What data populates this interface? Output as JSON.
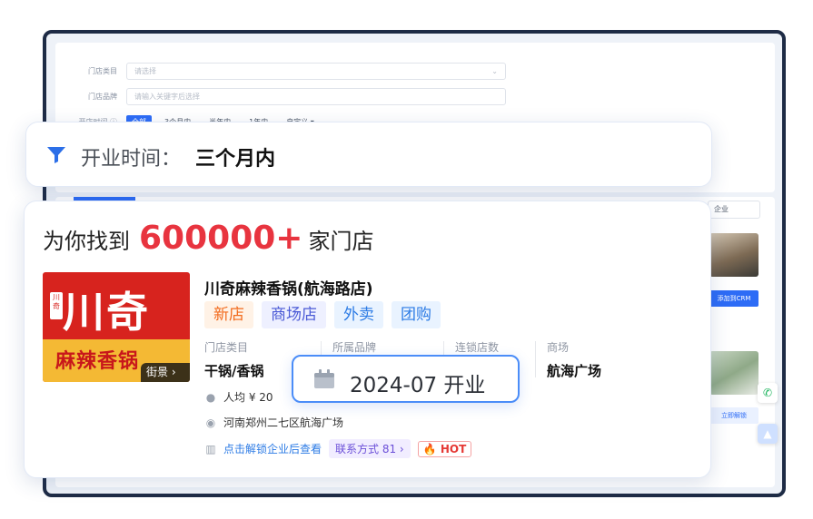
{
  "background": {
    "filters": [
      {
        "label": "门店类目",
        "placeholder": "请选择"
      },
      {
        "label": "门店品牌",
        "placeholder": "请输入关键字后选择"
      }
    ],
    "open_time": {
      "label": "开店时间 ⓘ",
      "options": [
        "全部",
        "3个月内",
        "半年内",
        "1年内",
        "自定义 ▾"
      ],
      "selected": "全部"
    },
    "select_value": "企业",
    "add_crm_button": "添加到CRM",
    "secondary_button": "立即解锁"
  },
  "time_filter": {
    "label": "开业时间：",
    "value": "三个月内",
    "icon": "funnel-icon",
    "accent": "#2c6fe8"
  },
  "result": {
    "prefix": "为你找到",
    "count": "600000+",
    "suffix": "家门店",
    "count_color": "#e8343f"
  },
  "store": {
    "logo": {
      "main": "川奇",
      "sub": "麻辣香锅",
      "seal": "川奇"
    },
    "streetview_label": "街景 ›",
    "name": "川奇麻辣香锅(航海路店)",
    "tags": [
      "新店",
      "商场店",
      "外卖",
      "团购"
    ],
    "fields": [
      {
        "label": "门店类目",
        "value": "干锅/香锅"
      },
      {
        "label": "所属品牌",
        "value": ""
      },
      {
        "label": "连锁店数",
        "value": ""
      },
      {
        "label": "商场",
        "value": "航海广场"
      }
    ],
    "avg_price": "人均 ¥ 20",
    "address": "河南郑州二七区航海广场",
    "unlock_text": "点击解锁企业后查看",
    "contact": "联系方式 81 ›",
    "hot": "🔥 HOT"
  },
  "opening_date": {
    "text": "2024-07 开业",
    "icon": "calendar-icon"
  }
}
